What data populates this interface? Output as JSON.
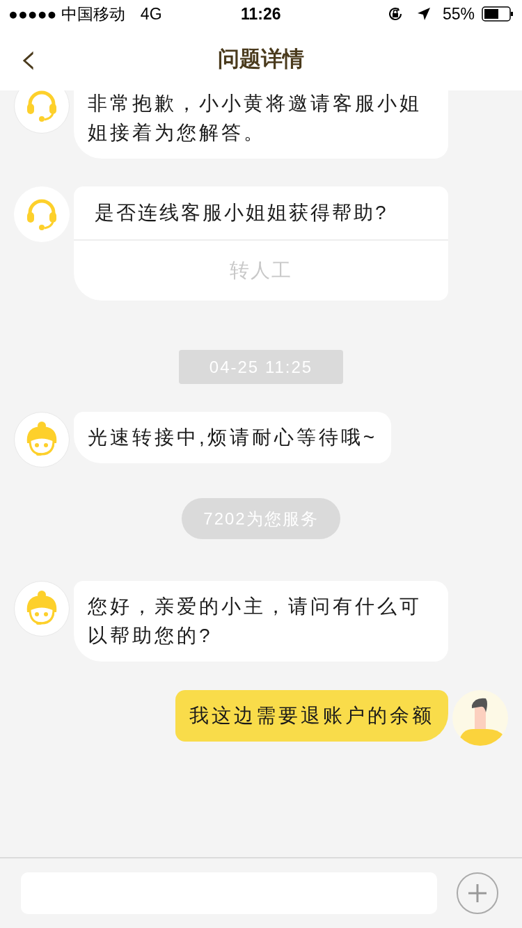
{
  "status_bar": {
    "carrier": "●●●●● 中国移动",
    "network": "4G",
    "time": "11:26",
    "battery": "55%"
  },
  "nav": {
    "back": "‹",
    "title": "问题详情"
  },
  "messages": [
    {
      "kind": "bot_text",
      "text": "非常抱歉，小小黄将邀请客服小姐姐接着为您解答。"
    },
    {
      "kind": "bot_prompt",
      "text": "是否连线客服小姐姐获得帮助?",
      "action": "转人工"
    },
    {
      "kind": "timestamp",
      "text": "04-25 11:25"
    },
    {
      "kind": "agent_text",
      "text": "光速转接中,烦请耐心等待哦~"
    },
    {
      "kind": "notice",
      "text": "7202为您服务"
    },
    {
      "kind": "agent_text",
      "text": "您好，亲爱的小主，请问有什么可以帮助您的?"
    },
    {
      "kind": "user_text",
      "text": "我这边需要退账户的余额"
    }
  ]
}
